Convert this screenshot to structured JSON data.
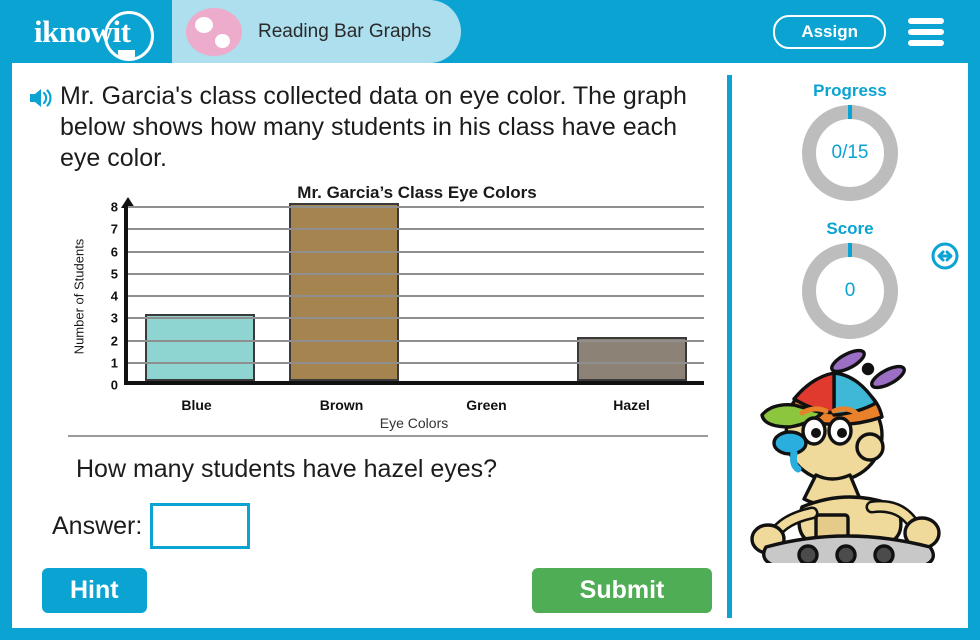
{
  "app": {
    "logo_text": "iknowit",
    "lesson_title": "Reading Bar Graphs"
  },
  "header": {
    "assign_label": "Assign",
    "menu_icon": "hamburger-menu-icon",
    "avatar_icon": "dice-avatar-icon"
  },
  "question": {
    "speaker_icon": "speaker-audio-icon",
    "passage": "Mr. Garcia's class collected data on eye color. The graph below shows how many students in his class have each eye color.",
    "prompt": "How many students have hazel eyes?",
    "answer_label": "Answer:",
    "answer_value": "",
    "answer_placeholder": ""
  },
  "actions": {
    "hint_label": "Hint",
    "submit_label": "Submit"
  },
  "sidebar": {
    "progress_label": "Progress",
    "progress_value": "0/15",
    "score_label": "Score",
    "score_value": "0",
    "mascot_name": "robot-mascot-propeller-hat",
    "resize_icon": "resize-horizontal-icon"
  },
  "colors": {
    "brand_cyan": "#0aa3d2",
    "header_pill": "#addfee",
    "avatar_pink": "#edaccb",
    "submit_green": "#4fad55",
    "ring_gray": "#bdbdbd"
  },
  "chart_data": {
    "type": "bar",
    "title": "Mr. Garcia’s Class Eye Colors",
    "xlabel": "Eye Colors",
    "ylabel": "Number of Students",
    "categories": [
      "Blue",
      "Brown",
      "Green",
      "Hazel"
    ],
    "values": [
      3,
      8,
      0,
      2
    ],
    "bar_colors": [
      "#8ed4d0",
      "#a5844f",
      "#ffffff",
      "#8c8376"
    ],
    "ylim": [
      0,
      8
    ],
    "yticks": [
      0,
      1,
      2,
      3,
      4,
      5,
      6,
      7,
      8
    ],
    "grid": true,
    "legend": false
  }
}
